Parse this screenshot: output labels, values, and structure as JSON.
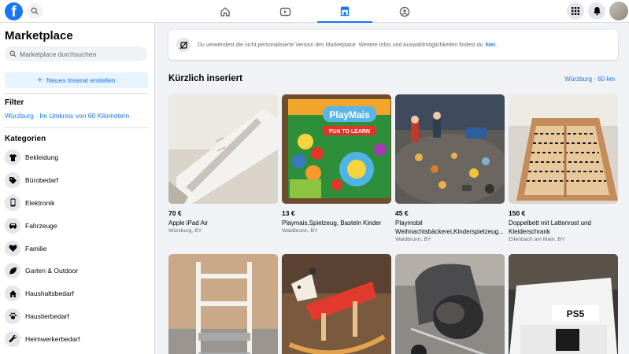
{
  "nav": {
    "logo": "f",
    "tabs": [
      {
        "name": "home-icon",
        "active": false
      },
      {
        "name": "video-icon",
        "active": false
      },
      {
        "name": "marketplace-icon",
        "active": true
      },
      {
        "name": "groups-icon",
        "active": false
      }
    ]
  },
  "sidebar": {
    "title": "Marketplace",
    "search_placeholder": "Marketplace durchsuchen",
    "new_listing_label": "Neues Inserat erstellen",
    "filter_heading": "Filter",
    "filter_location": "Würzburg · Im Umkreis von 60 Kilometern",
    "categories_heading": "Kategorien",
    "categories": [
      {
        "label": "Bekleidung",
        "icon": "shirt-icon"
      },
      {
        "label": "Bürobedarf",
        "icon": "tag-icon"
      },
      {
        "label": "Elektronik",
        "icon": "phone-icon"
      },
      {
        "label": "Fahrzeuge",
        "icon": "car-icon"
      },
      {
        "label": "Familie",
        "icon": "heart-icon"
      },
      {
        "label": "Garten & Outdoor",
        "icon": "leaf-icon"
      },
      {
        "label": "Haushaltsbedarf",
        "icon": "house-icon"
      },
      {
        "label": "Haustierbedarf",
        "icon": "paw-icon"
      },
      {
        "label": "Heimwerkerbedarf",
        "icon": "wrench-icon"
      }
    ]
  },
  "banner": {
    "text": "Du verwendest die nicht personalisierte Version des Marketplace. Weitere Infos und Auswahlmöglichkeiten findest du",
    "link": "hier."
  },
  "main": {
    "section_title": "Kürzlich inseriert",
    "location": "Würzburg · 60 km",
    "listings": [
      {
        "price": "70 €",
        "title": "Apple iPad Air",
        "location": "Würzburg, BY"
      },
      {
        "price": "13 €",
        "title": "Playmais,Spielzeug, Basteln Kinder",
        "location": "Waldbrunn, BY"
      },
      {
        "price": "45 €",
        "title": "Playmobil Weihnachtsbäckerei,Kinderspielzeug...",
        "location": "Waldbrunn, BY"
      },
      {
        "price": "150 €",
        "title": "Doppelbett mit Lattenrost und Kleiderschrank",
        "location": "Erlenbach am Main, BY"
      },
      {
        "price": "",
        "title": "",
        "location": ""
      },
      {
        "price": "",
        "title": "",
        "location": ""
      },
      {
        "price": "",
        "title": "",
        "location": ""
      },
      {
        "price": "",
        "title": "",
        "location": ""
      }
    ],
    "playmais_logo": "PlayMais",
    "playmais_tag": "FUN TO LEARN",
    "ps5_label": "PS5"
  },
  "colors": {
    "accent": "#1877f2",
    "background": "#f0f2f5"
  }
}
